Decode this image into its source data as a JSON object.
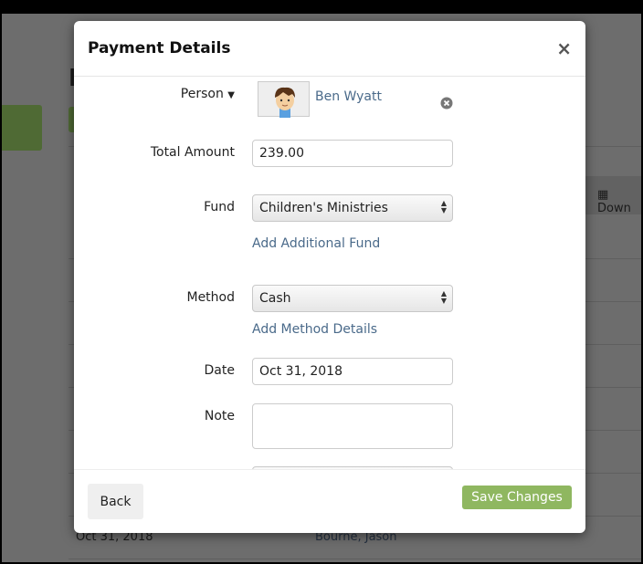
{
  "background": {
    "title_fragment": "P",
    "download_label": "Down",
    "last_row": {
      "date": "Oct 31, 2018",
      "name": "Bourne, Jason"
    }
  },
  "modal": {
    "title": "Payment Details",
    "close_icon": "×",
    "person": {
      "label": "Person",
      "name": "Ben Wyatt"
    },
    "total_amount": {
      "label": "Total Amount",
      "value": "239.00"
    },
    "fund": {
      "label": "Fund",
      "value": "Children's Ministries",
      "add_link": "Add Additional Fund"
    },
    "method": {
      "label": "Method",
      "value": "Cash",
      "add_link": "Add Method Details"
    },
    "date": {
      "label": "Date",
      "value": "Oct 31, 2018"
    },
    "note": {
      "label": "Note",
      "value": ""
    },
    "back_label": "Back",
    "save_label": "Save Changes"
  },
  "colors": {
    "accent": "#8fb760",
    "link": "#4a6a8a"
  }
}
